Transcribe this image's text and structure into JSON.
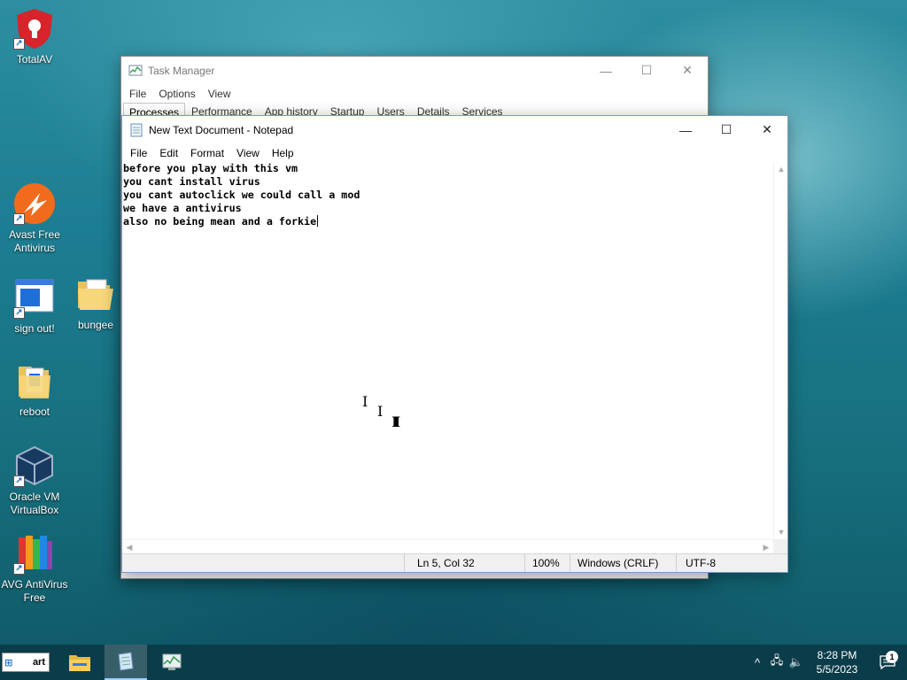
{
  "desktop": {
    "icons": [
      {
        "label": "TotalAV",
        "icon": "shield-icon"
      },
      {
        "label": "Avast Free Antivirus",
        "icon": "avast-icon"
      },
      {
        "label": "sign out!",
        "icon": "window-shortcut-icon"
      },
      {
        "label": "bungee",
        "icon": "folder-icon"
      },
      {
        "label": "reboot",
        "icon": "folder-icon"
      },
      {
        "label": "Oracle VM VirtualBox",
        "icon": "virtualbox-icon"
      },
      {
        "label": "AVG AntiVirus Free",
        "icon": "avg-icon"
      }
    ]
  },
  "taskmanager": {
    "title": "Task Manager",
    "menu": [
      "File",
      "Options",
      "View"
    ],
    "tabs": [
      "Processes",
      "Performance",
      "App history",
      "Startup",
      "Users",
      "Details",
      "Services"
    ],
    "active_tab": "Processes"
  },
  "notepad": {
    "title": "New Text Document - Notepad",
    "menu": [
      "File",
      "Edit",
      "Format",
      "View",
      "Help"
    ],
    "lines": [
      "before you play with this vm",
      "you cant install virus",
      "you cant autoclick we could call a mod",
      "we have a antivirus",
      "also no being mean and a forkie"
    ],
    "status": {
      "position": "Ln 5, Col 32",
      "zoom": "100%",
      "line_ending": "Windows (CRLF)",
      "encoding": "UTF-8"
    }
  },
  "window_controls": {
    "minimize": "—",
    "maximize": "☐",
    "close": "✕"
  },
  "taskbar": {
    "start_label": "art",
    "apps": [
      "file-explorer-icon",
      "notepad-icon",
      "task-manager-icon"
    ],
    "tray": {
      "chevron": "^",
      "network": "🖧",
      "volume": "🔈",
      "time": "8:28 PM",
      "date": "5/5/2023",
      "notification_count": "1"
    }
  },
  "colors": {
    "accent": "#0078d7",
    "taskbar": "#0b3c4a"
  }
}
